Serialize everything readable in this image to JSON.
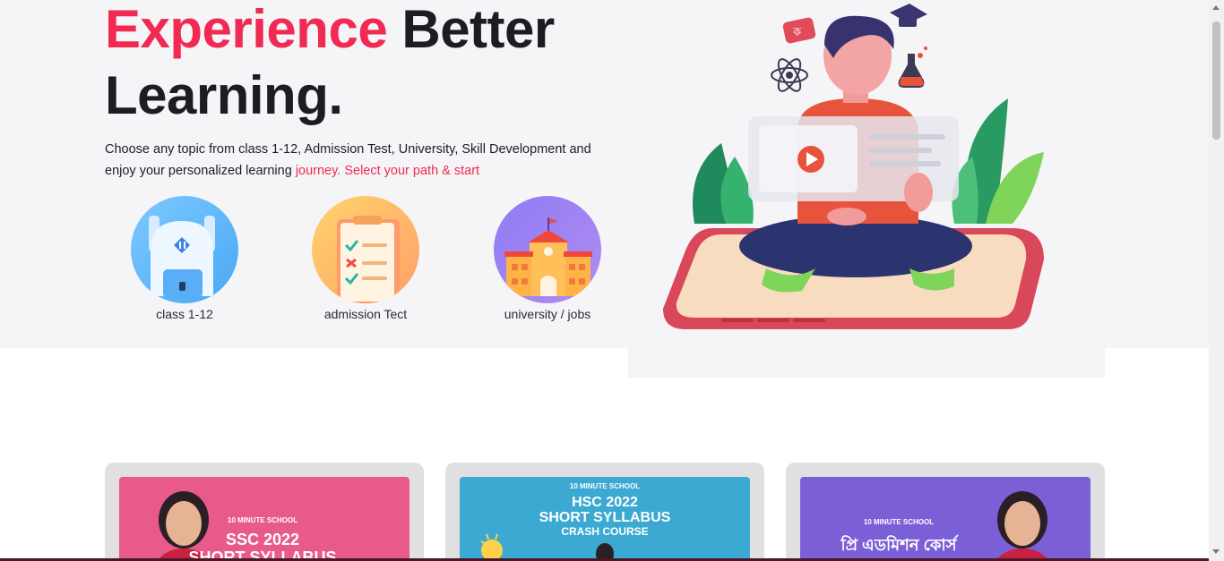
{
  "hero": {
    "headline_accent": "Experience",
    "headline_rest": " Better",
    "headline_line2": "Learning.",
    "description_main": "Choose any topic from class 1-12, Admission Test, University, Skill Development and enjoy your personalized learning ",
    "description_highlight": "journey. Select your path & start"
  },
  "categories": [
    {
      "label": "class 1-12",
      "icon": "backpack-icon"
    },
    {
      "label": "admission Tect",
      "icon": "checklist-icon"
    },
    {
      "label": "university / jobs",
      "icon": "school-building-icon"
    }
  ],
  "courses": [
    {
      "brand": "10 MINUTE SCHOOL",
      "title": "SSC 2022",
      "subtitle": "SHORT SYLLABUS",
      "color": "#e85a8a"
    },
    {
      "brand": "10 MINUTE SCHOOL",
      "title": "HSC 2022",
      "subtitle": "SHORT SYLLABUS",
      "tagline": "CRASH COURSE",
      "color": "#3ba9d1"
    },
    {
      "brand": "10 MINUTE SCHOOL",
      "title": "প্রি এডমিশন কোর্স",
      "color": "#7b5fd6"
    }
  ],
  "colors": {
    "accent": "#f02a52",
    "hero_bg": "#f5f5f7",
    "text": "#1c1c24"
  }
}
